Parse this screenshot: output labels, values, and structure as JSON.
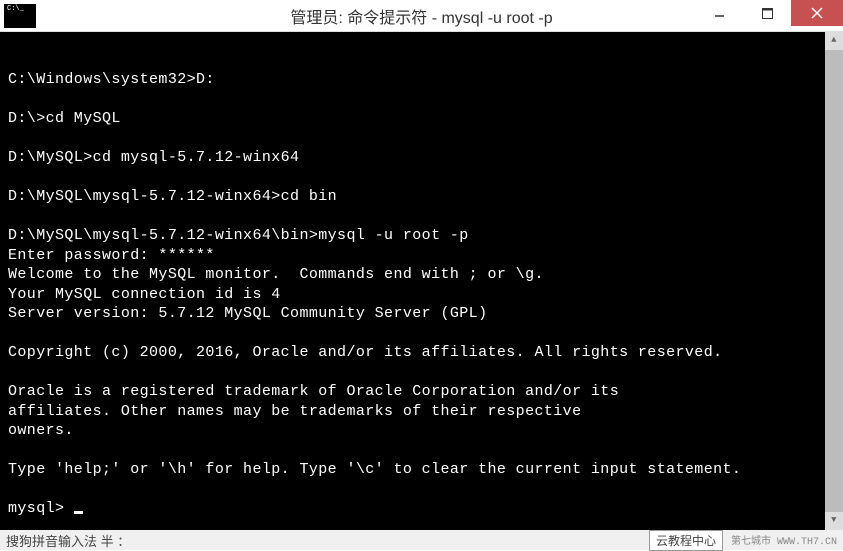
{
  "window": {
    "title": "管理员: 命令提示符 - mysql  -u root -p",
    "icon_text": "C:\\_"
  },
  "terminal": {
    "lines": [
      "C:\\Windows\\system32>D:",
      "",
      "D:\\>cd MySQL",
      "",
      "D:\\MySQL>cd mysql-5.7.12-winx64",
      "",
      "D:\\MySQL\\mysql-5.7.12-winx64>cd bin",
      "",
      "D:\\MySQL\\mysql-5.7.12-winx64\\bin>mysql -u root -p",
      "Enter password: ******",
      "Welcome to the MySQL monitor.  Commands end with ; or \\g.",
      "Your MySQL connection id is 4",
      "Server version: 5.7.12 MySQL Community Server (GPL)",
      "",
      "Copyright (c) 2000, 2016, Oracle and/or its affiliates. All rights reserved.",
      "",
      "Oracle is a registered trademark of Oracle Corporation and/or its",
      "affiliates. Other names may be trademarks of their respective",
      "owners.",
      "",
      "Type 'help;' or '\\h' for help. Type '\\c' to clear the current input statement.",
      ""
    ],
    "prompt": "mysql> "
  },
  "bottom": {
    "ime_text": "搜狗拼音输入法 半 ：",
    "label": "云教程中心",
    "small": "第七城市  WWW.TH7.CN"
  }
}
